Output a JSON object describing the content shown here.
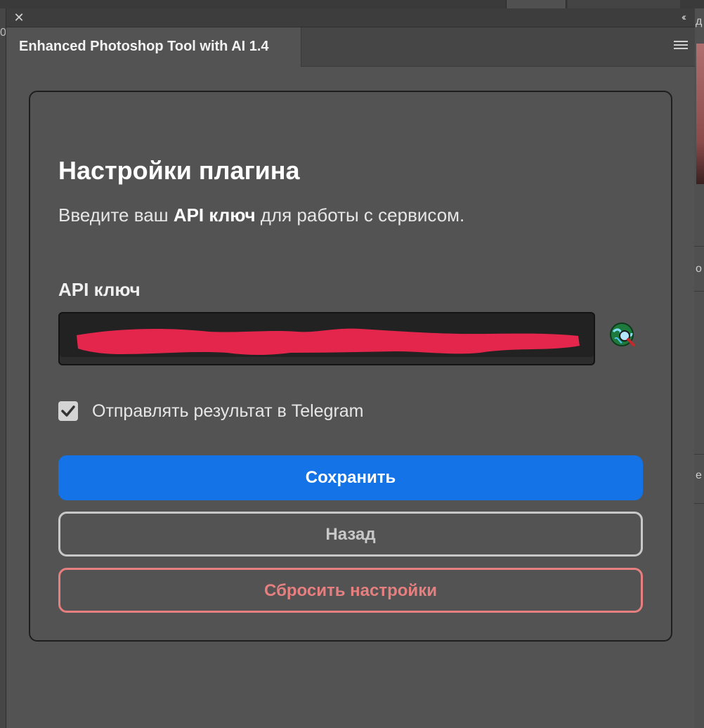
{
  "window": {
    "close_glyph": "✕",
    "collapse_glyph": "‹‹",
    "tab_label": "Enhanced Photoshop Tool with AI 1.4"
  },
  "settings": {
    "title": "Настройки плагина",
    "description_pre": "Введите ваш ",
    "description_bold": "API ключ",
    "description_post": " для работы с сервисом.",
    "api_key_label": "API ключ",
    "api_key_value": "",
    "telegram_checkbox": {
      "label": "Отправлять результат в Telegram",
      "checked": true
    },
    "buttons": {
      "save": "Сохранить",
      "back": "Назад",
      "reset": "Сбросить настройки"
    }
  },
  "background": {
    "left_partial_glyph": "0",
    "right_partial_glyphs": [
      "д",
      "о",
      "е"
    ]
  },
  "colors": {
    "accent": "#1473e6",
    "danger": "#e67f7f",
    "redaction": "#e4264c"
  }
}
